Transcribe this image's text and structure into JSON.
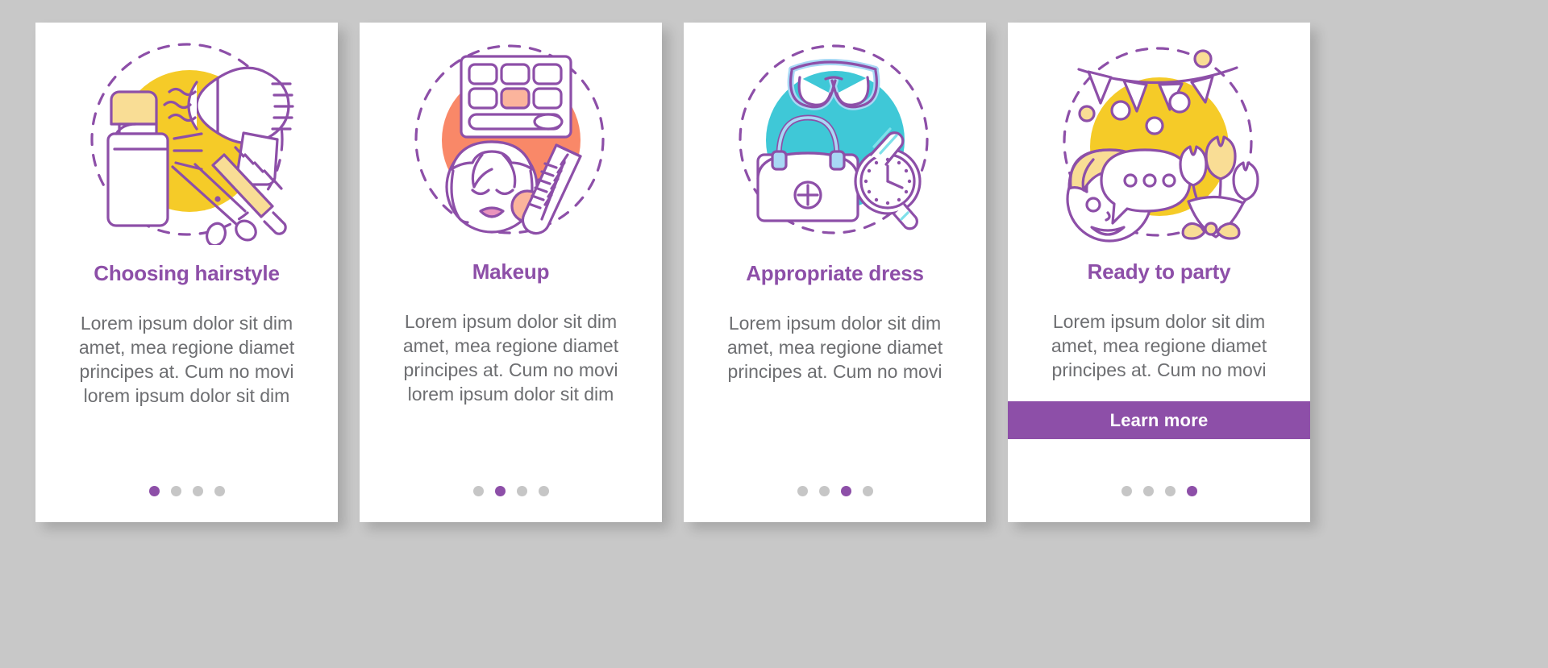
{
  "theme": {
    "page_background": "#c8c8c8",
    "card_background": "#ffffff",
    "title_color": "#8d4fa8",
    "body_color": "#6d6e71",
    "accent_purple": "#8d4fa8",
    "dot_inactive": "#c6c6c6",
    "blob_yellow": "#f5cb28",
    "blob_coral": "#f98868",
    "blob_teal": "#3fc8d7",
    "line_purple": "#8d4fa8",
    "fill_light_yellow": "#f9dd95",
    "fill_light_coral": "#fbb49c",
    "fill_light_blue": "#a8d8f5"
  },
  "screens": [
    {
      "id": "choosing-hairstyle",
      "title": "Choosing hairstyle",
      "body": "Lorem ipsum dolor sit dim amet, mea regione diamet principes at. Cum no movi lorem ipsum dolor sit dim",
      "illustration": "hairstyle-icon",
      "blob_color": "#f5cb28",
      "dots": {
        "count": 4,
        "active_index": 0
      },
      "button": null
    },
    {
      "id": "makeup",
      "title": "Makeup",
      "body": "Lorem ipsum dolor sit dim amet, mea regione diamet principes at. Cum no movi lorem ipsum dolor sit dim",
      "illustration": "makeup-icon",
      "blob_color": "#f98868",
      "dots": {
        "count": 4,
        "active_index": 1
      },
      "button": null
    },
    {
      "id": "appropriate-dress",
      "title": "Appropriate dress",
      "body": "Lorem ipsum dolor sit dim amet, mea regione diamet principes at. Cum no movi",
      "illustration": "dress-accessories-icon",
      "blob_color": "#3fc8d7",
      "dots": {
        "count": 4,
        "active_index": 2
      },
      "button": null
    },
    {
      "id": "ready-to-party",
      "title": "Ready to party",
      "body": "Lorem ipsum dolor sit dim amet, mea regione diamet principes at. Cum no movi",
      "illustration": "party-icon",
      "blob_color": "#f5cb28",
      "dots": {
        "count": 4,
        "active_index": 3
      },
      "button": {
        "label": "Learn more"
      }
    }
  ]
}
